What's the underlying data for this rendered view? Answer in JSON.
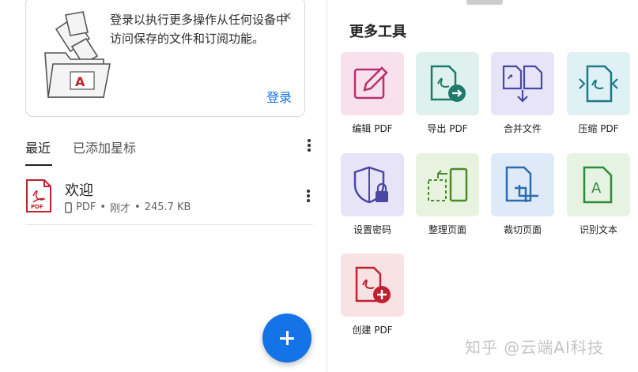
{
  "promo": {
    "text": "登录以执行更多操作从任何设备中访问保存的文件和订阅功能。",
    "login_label": "登录",
    "close_glyph": "×"
  },
  "tabs": [
    {
      "label": "最近",
      "active": true
    },
    {
      "label": "已添加星标",
      "active": false
    }
  ],
  "files": [
    {
      "name": "欢迎",
      "icon": "pdf-file-icon",
      "device_icon": "phone-icon",
      "type": "PDF",
      "sep1": "•",
      "time": "刚才",
      "sep2": "•",
      "size": "245.7 KB"
    }
  ],
  "fab_icon": "plus-icon",
  "tools_title": "更多工具",
  "tools": [
    {
      "label": "编辑 PDF",
      "icon": "edit-pdf-icon",
      "bg": "#f8e1ec",
      "color": "#b5316f"
    },
    {
      "label": "导出 PDF",
      "icon": "export-pdf-icon",
      "bg": "#dff1ee",
      "color": "#1e7a6a"
    },
    {
      "label": "合并文件",
      "icon": "combine-files-icon",
      "bg": "#e6e4f6",
      "color": "#4b47a6"
    },
    {
      "label": "压缩 PDF",
      "icon": "compress-pdf-icon",
      "bg": "#dff1f4",
      "color": "#1e7a85"
    },
    {
      "label": "设置密码",
      "icon": "protect-pdf-icon",
      "bg": "#e6e4f6",
      "color": "#4b47a6"
    },
    {
      "label": "整理页面",
      "icon": "organize-pages-icon",
      "bg": "#e7f3df",
      "color": "#4a8c2a"
    },
    {
      "label": "裁切页面",
      "icon": "crop-pages-icon",
      "bg": "#dfeaf8",
      "color": "#2b6cb0"
    },
    {
      "label": "识别文本",
      "icon": "recognize-text-icon",
      "bg": "#e6f3e3",
      "color": "#2e8b3a"
    },
    {
      "label": "创建 PDF",
      "icon": "create-pdf-icon",
      "bg": "#f9e2e3",
      "color": "#c0212e"
    }
  ],
  "watermark": "知乎 @云端AI科技"
}
